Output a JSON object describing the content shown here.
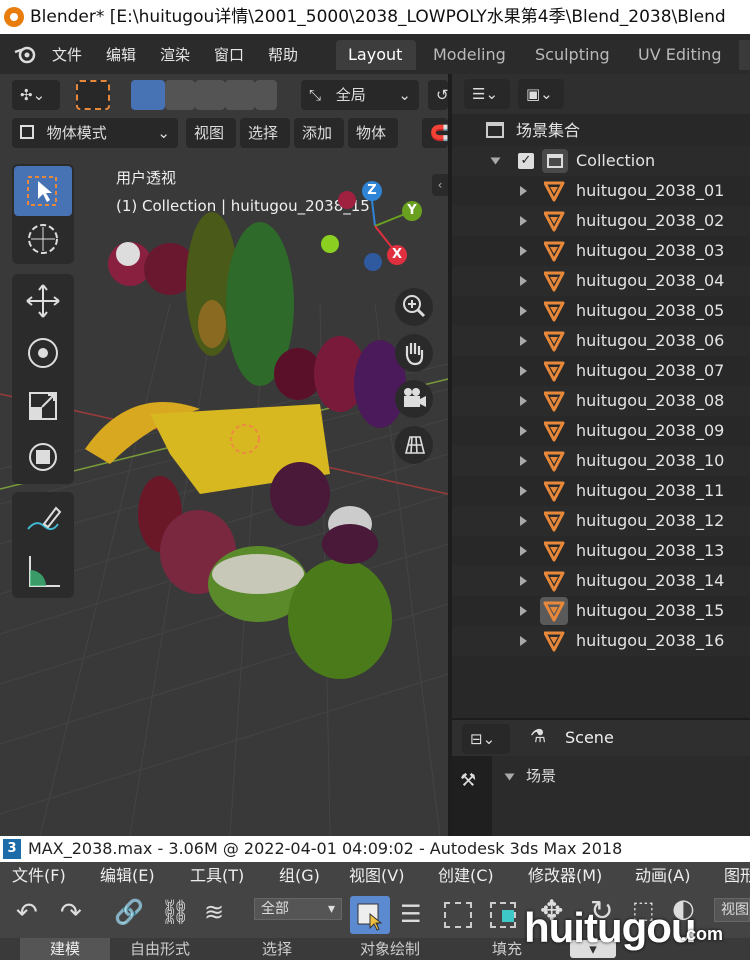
{
  "blender": {
    "window_title": "Blender* [E:\\huitugou详情\\2001_5000\\2038_LOWPOLY水果第4季\\Blend_2038\\Blend",
    "menu": [
      "文件",
      "编辑",
      "渲染",
      "窗口",
      "帮助"
    ],
    "workspace_tabs": [
      "Layout",
      "Modeling",
      "Sculpting",
      "UV Editing"
    ],
    "active_workspace": "Layout",
    "viewport": {
      "transform_orientation": "全局",
      "mode": "物体模式",
      "header_menus": [
        "视图",
        "选择",
        "添加",
        "物体"
      ],
      "view_name": "用户透视",
      "view_info": "(1) Collection | huitugou_2038_15",
      "gizmo_axes": {
        "z": "Z",
        "y": "Y",
        "x": "X"
      },
      "tools": [
        "select-box-tool",
        "cursor-tool",
        "move-tool",
        "rotate-tool",
        "scale-tool",
        "transform-tool",
        "annotate-tool",
        "measure-tool"
      ]
    },
    "outliner": {
      "scene_collection": "场景集合",
      "collection": "Collection",
      "objects": [
        "huitugou_2038_01",
        "huitugou_2038_02",
        "huitugou_2038_03",
        "huitugou_2038_04",
        "huitugou_2038_05",
        "huitugou_2038_06",
        "huitugou_2038_07",
        "huitugou_2038_08",
        "huitugou_2038_09",
        "huitugou_2038_10",
        "huitugou_2038_11",
        "huitugou_2038_12",
        "huitugou_2038_13",
        "huitugou_2038_14",
        "huitugou_2038_15",
        "huitugou_2038_16"
      ],
      "active_object_index": 14
    },
    "properties": {
      "scene_label": "Scene",
      "section": "场景"
    }
  },
  "max": {
    "window_title": "MAX_2038.max - 3.06M @ 2022-04-01 04:09:02 - Autodesk 3ds Max 2018",
    "menu": [
      "文件(F)",
      "编辑(E)",
      "工具(T)",
      "组(G)",
      "视图(V)",
      "创建(C)",
      "修改器(M)",
      "动画(A)",
      "图形"
    ],
    "selection_filter": "全部",
    "view_label": "视图",
    "ribbon_tabs": [
      "建模",
      "自由形式",
      "选择",
      "对象绘制",
      "填充"
    ]
  },
  "watermark": {
    "main": "huitugou",
    "suffix": ".com"
  },
  "colors": {
    "accent": "#4772b3",
    "object_icon": "#e8883a",
    "axis_x": "#e03040",
    "axis_y": "#6aa020",
    "axis_z": "#2f84d6"
  }
}
